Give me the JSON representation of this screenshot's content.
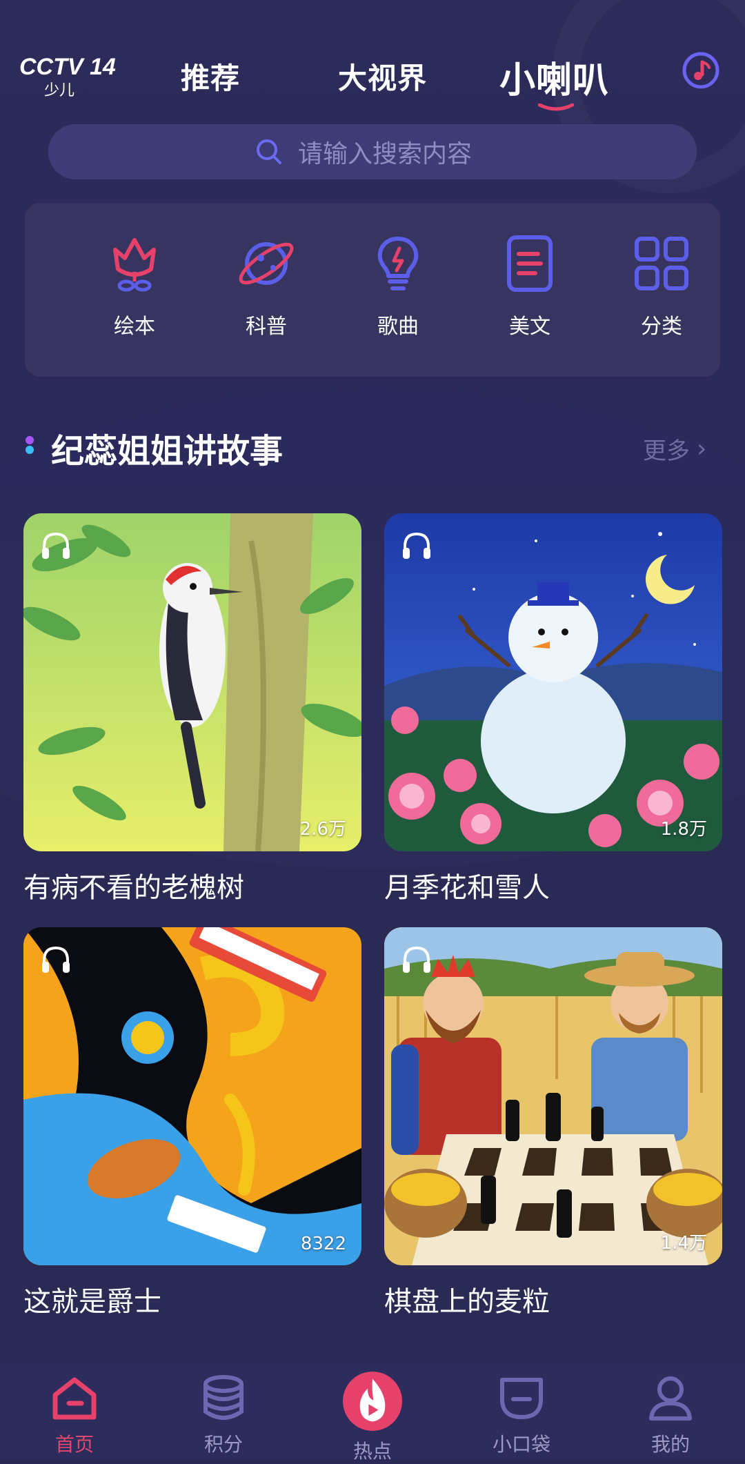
{
  "header": {
    "logo_text": "CCTV 14",
    "logo_sub": "少儿",
    "tabs": [
      "推荐",
      "大视界",
      "小喇叭"
    ],
    "active_tab": "小喇叭"
  },
  "search": {
    "placeholder": "请输入搜索内容"
  },
  "categories": [
    {
      "label": "绘本",
      "icon": "flower-book-icon"
    },
    {
      "label": "科普",
      "icon": "planet-icon"
    },
    {
      "label": "歌曲",
      "icon": "lightbulb-icon"
    },
    {
      "label": "美文",
      "icon": "document-icon"
    },
    {
      "label": "分类",
      "icon": "grid-icon"
    }
  ],
  "section": {
    "title": "纪蕊姐姐讲故事",
    "more": "更多"
  },
  "stories": [
    {
      "title": "有病不看的老槐树",
      "plays": "2.6万"
    },
    {
      "title": "月季花和雪人",
      "plays": "1.8万"
    },
    {
      "title": "这就是爵士",
      "plays": "8322"
    },
    {
      "title": "棋盘上的麦粒",
      "plays": "1.4万"
    }
  ],
  "tabbar": [
    {
      "label": "首页",
      "icon": "home-icon"
    },
    {
      "label": "积分",
      "icon": "coins-icon"
    },
    {
      "label": "热点",
      "icon": "flame-play-icon"
    },
    {
      "label": "小口袋",
      "icon": "pocket-icon"
    },
    {
      "label": "我的",
      "icon": "user-icon"
    }
  ],
  "colors": {
    "background": "#2b2a55",
    "accent": "#e5416a",
    "icon_blue": "#5b5ee8",
    "panel": "#37355f"
  }
}
